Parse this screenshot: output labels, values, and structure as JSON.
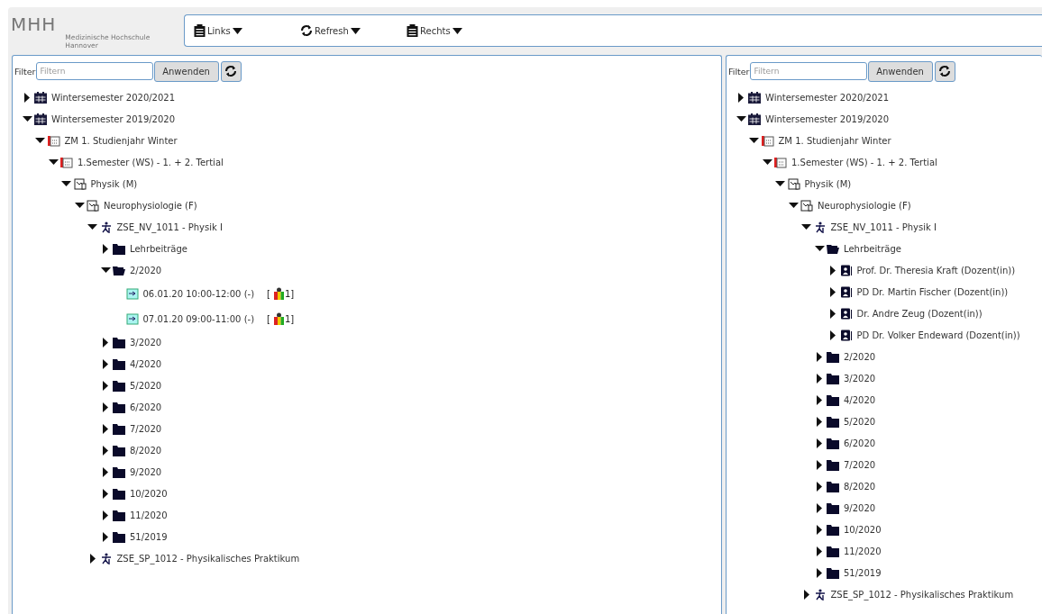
{
  "logo": {
    "mark": "MHH",
    "name": "Medizinische Hochschule",
    "city": "Hannover"
  },
  "toolbar": [
    {
      "label": "Links",
      "kind": "panel"
    },
    {
      "label": "Refresh",
      "kind": "refresh"
    },
    {
      "label": "Rechts",
      "kind": "panel"
    }
  ],
  "panes": [
    {
      "filter": {
        "label": "Filter",
        "placeholder": "Filtern",
        "apply": "Anwenden"
      },
      "tree": [
        {
          "kind": "calendar",
          "label": "Wintersemester 2020/2021",
          "expanded": false
        },
        {
          "kind": "calendar",
          "label": "Wintersemester 2019/2020",
          "expanded": true,
          "children": [
            {
              "kind": "year",
              "label": "ZM 1. Studienjahr Winter",
              "expanded": true,
              "children": [
                {
                  "kind": "semester",
                  "label": "1.Semester (WS) - 1. + 2. Tertial",
                  "expanded": true,
                  "children": [
                    {
                      "kind": "subject",
                      "label": "Physik (M)",
                      "expanded": true,
                      "children": [
                        {
                          "kind": "subject",
                          "label": "Neurophysiologie (F)",
                          "expanded": true,
                          "children": [
                            {
                              "kind": "course",
                              "label": "ZSE_NV_1011 - Physik I",
                              "expanded": true,
                              "children": [
                                {
                                  "kind": "folder",
                                  "label": "Lehrbeiträge",
                                  "expanded": false
                                },
                                {
                                  "kind": "folder",
                                  "label": "2/2020",
                                  "expanded": true,
                                  "children": [
                                    {
                                      "kind": "event",
                                      "label": "06.01.20  10:00-12:00 (-)",
                                      "badge_open": "[",
                                      "badge": "1]"
                                    },
                                    {
                                      "kind": "event",
                                      "label": "07.01.20  09:00-11:00 (-)",
                                      "badge_open": "[",
                                      "badge": "1]"
                                    }
                                  ]
                                },
                                {
                                  "kind": "folder",
                                  "label": "3/2020",
                                  "expanded": false
                                },
                                {
                                  "kind": "folder",
                                  "label": "4/2020",
                                  "expanded": false
                                },
                                {
                                  "kind": "folder",
                                  "label": "5/2020",
                                  "expanded": false
                                },
                                {
                                  "kind": "folder",
                                  "label": "6/2020",
                                  "expanded": false
                                },
                                {
                                  "kind": "folder",
                                  "label": "7/2020",
                                  "expanded": false
                                },
                                {
                                  "kind": "folder",
                                  "label": "8/2020",
                                  "expanded": false
                                },
                                {
                                  "kind": "folder",
                                  "label": "9/2020",
                                  "expanded": false
                                },
                                {
                                  "kind": "folder",
                                  "label": "10/2020",
                                  "expanded": false
                                },
                                {
                                  "kind": "folder",
                                  "label": "11/2020",
                                  "expanded": false
                                },
                                {
                                  "kind": "folder",
                                  "label": "51/2019",
                                  "expanded": false
                                }
                              ]
                            },
                            {
                              "kind": "course",
                              "label": "ZSE_SP_1012 - Physikalisches Praktikum",
                              "expanded": false
                            }
                          ]
                        }
                      ]
                    }
                  ]
                }
              ]
            }
          ]
        }
      ]
    },
    {
      "filter": {
        "label": "Filter",
        "placeholder": "Filtern",
        "apply": "Anwenden"
      },
      "tree": [
        {
          "kind": "calendar",
          "label": "Wintersemester 2020/2021",
          "expanded": false
        },
        {
          "kind": "calendar",
          "label": "Wintersemester 2019/2020",
          "expanded": true,
          "children": [
            {
              "kind": "year",
              "label": "ZM 1. Studienjahr Winter",
              "expanded": true,
              "children": [
                {
                  "kind": "semester",
                  "label": "1.Semester (WS) - 1. + 2. Tertial",
                  "expanded": true,
                  "children": [
                    {
                      "kind": "subject",
                      "label": "Physik (M)",
                      "expanded": true,
                      "children": [
                        {
                          "kind": "subject",
                          "label": "Neurophysiologie (F)",
                          "expanded": true,
                          "children": [
                            {
                              "kind": "course",
                              "label": "ZSE_NV_1011 - Physik I",
                              "expanded": true,
                              "children": [
                                {
                                  "kind": "folder",
                                  "label": "Lehrbeiträge",
                                  "expanded": true,
                                  "children": [
                                    {
                                      "kind": "person",
                                      "label": "Prof. Dr. Theresia Kraft (Dozent(in))",
                                      "expanded": false
                                    },
                                    {
                                      "kind": "person",
                                      "label": "PD Dr. Martin Fischer (Dozent(in))",
                                      "expanded": false
                                    },
                                    {
                                      "kind": "person",
                                      "label": "Dr. Andre Zeug (Dozent(in))",
                                      "expanded": false
                                    },
                                    {
                                      "kind": "person",
                                      "label": "PD Dr. Volker Endeward (Dozent(in))",
                                      "expanded": false
                                    }
                                  ]
                                },
                                {
                                  "kind": "folder",
                                  "label": "2/2020",
                                  "expanded": false
                                },
                                {
                                  "kind": "folder",
                                  "label": "3/2020",
                                  "expanded": false
                                },
                                {
                                  "kind": "folder",
                                  "label": "4/2020",
                                  "expanded": false
                                },
                                {
                                  "kind": "folder",
                                  "label": "5/2020",
                                  "expanded": false
                                },
                                {
                                  "kind": "folder",
                                  "label": "6/2020",
                                  "expanded": false
                                },
                                {
                                  "kind": "folder",
                                  "label": "7/2020",
                                  "expanded": false
                                },
                                {
                                  "kind": "folder",
                                  "label": "8/2020",
                                  "expanded": false
                                },
                                {
                                  "kind": "folder",
                                  "label": "9/2020",
                                  "expanded": false
                                },
                                {
                                  "kind": "folder",
                                  "label": "10/2020",
                                  "expanded": false
                                },
                                {
                                  "kind": "folder",
                                  "label": "11/2020",
                                  "expanded": false
                                },
                                {
                                  "kind": "folder",
                                  "label": "51/2019",
                                  "expanded": false
                                }
                              ]
                            },
                            {
                              "kind": "course",
                              "label": "ZSE_SP_1012 - Physikalisches Praktikum",
                              "expanded": false
                            }
                          ]
                        }
                      ]
                    }
                  ]
                }
              ]
            }
          ]
        }
      ]
    }
  ]
}
